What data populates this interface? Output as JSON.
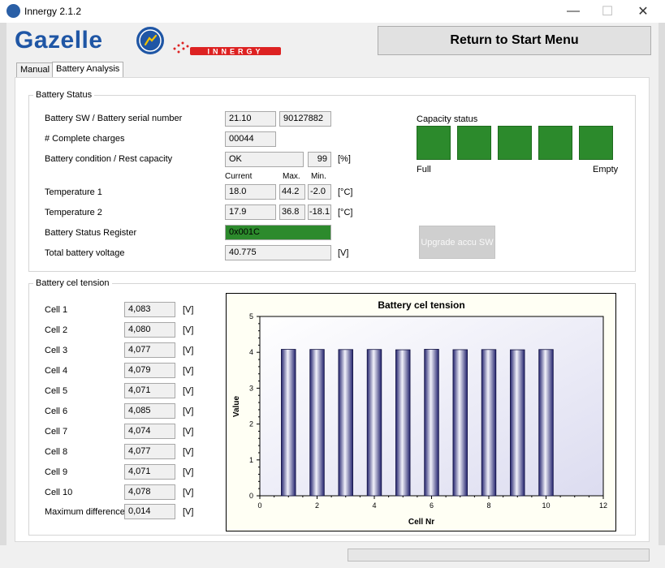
{
  "window": {
    "title": "Innergy 2.1.2",
    "controls": {
      "minimize": "—",
      "maximize": "☐",
      "close": "✕"
    }
  },
  "header": {
    "brand": "Gazelle",
    "innergy_logo_text": "INNERGY",
    "return_label": "Return to Start Menu"
  },
  "tabs": [
    {
      "label": "Manual",
      "active": false
    },
    {
      "label": "Battery Analysis",
      "active": true
    }
  ],
  "battery_status": {
    "group_label": "Battery Status",
    "sw_serial": {
      "label": "Battery SW / Battery serial number",
      "sw": "21.10",
      "serial": "90127882"
    },
    "charges": {
      "label": "# Complete charges",
      "value": "00044"
    },
    "condition": {
      "label": "Battery condition / Rest capacity",
      "status": "OK",
      "rest": "99",
      "unit": "[%]"
    },
    "headers": {
      "current": "Current",
      "max": "Max.",
      "min": "Min."
    },
    "temp1": {
      "label": "Temperature 1",
      "current": "18.0",
      "max": "44.2",
      "min": "-2.0",
      "unit": "[°C]"
    },
    "temp2": {
      "label": "Temperature 2",
      "current": "17.9",
      "max": "36.8",
      "min": "-18.1",
      "unit": "[°C]"
    },
    "register": {
      "label": "Battery Status Register",
      "value": "0x001C",
      "color": "#2c8a2c"
    },
    "voltage": {
      "label": "Total battery voltage",
      "value": "40.775",
      "unit": "[V]"
    },
    "capacity": {
      "label": "Capacity status",
      "full": "Full",
      "empty": "Empty",
      "segments_filled": 5,
      "segments_total": 5,
      "color": "#2c8a2c"
    },
    "upgrade_label": "Upgrade accu SW"
  },
  "cel_tension": {
    "group_label": "Battery cel tension",
    "unit": "[V]",
    "cells": [
      {
        "label": "Cell 1",
        "value": "4,083"
      },
      {
        "label": "Cell 2",
        "value": "4,080"
      },
      {
        "label": "Cell 3",
        "value": "4,077"
      },
      {
        "label": "Cell 4",
        "value": "4,079"
      },
      {
        "label": "Cell 5",
        "value": "4,071"
      },
      {
        "label": "Cell 6",
        "value": "4,085"
      },
      {
        "label": "Cell 7",
        "value": "4,074"
      },
      {
        "label": "Cell 8",
        "value": "4,077"
      },
      {
        "label": "Cell 9",
        "value": "4,071"
      },
      {
        "label": "Cell 10",
        "value": "4,078"
      }
    ],
    "max_diff": {
      "label": "Maximum difference",
      "value": "0,014"
    }
  },
  "chart_data": {
    "type": "bar",
    "title": "Battery cel tension",
    "xlabel": "Cell Nr",
    "ylabel": "Value",
    "x": [
      1,
      2,
      3,
      4,
      5,
      6,
      7,
      8,
      9,
      10
    ],
    "values": [
      4.083,
      4.08,
      4.077,
      4.079,
      4.071,
      4.085,
      4.074,
      4.077,
      4.071,
      4.078
    ],
    "xlim": [
      0,
      12
    ],
    "ylim": [
      0,
      5
    ],
    "xticks": [
      0,
      2,
      4,
      6,
      8,
      10,
      12
    ],
    "yticks": [
      0,
      1,
      2,
      3,
      4,
      5
    ],
    "grid": false,
    "legend": "none",
    "bar_color": "#2b2b7a"
  }
}
